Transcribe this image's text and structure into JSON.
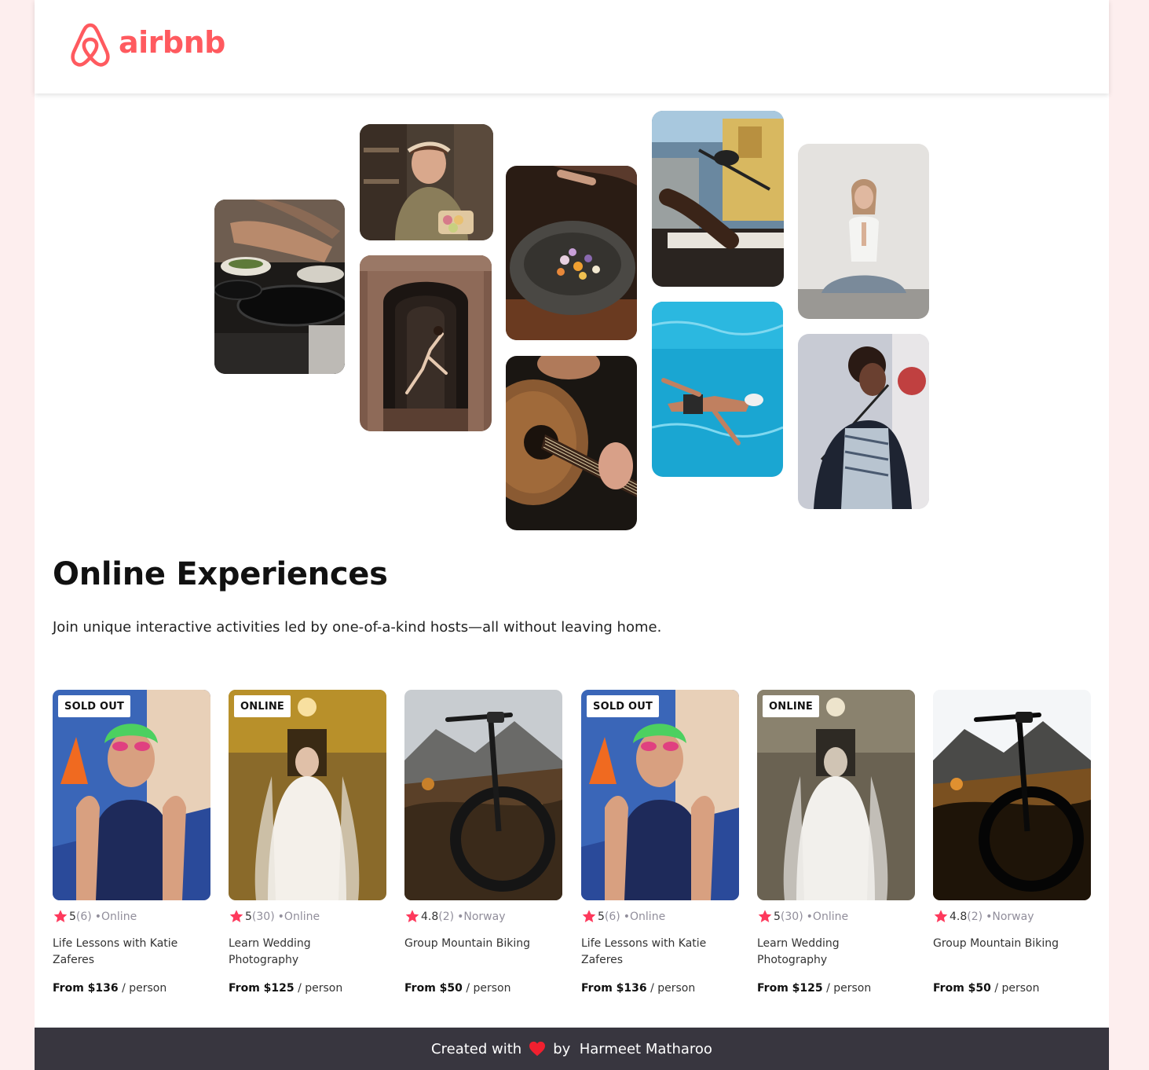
{
  "brand": {
    "name": "airbnb",
    "color": "#ff5a5f"
  },
  "hero": {
    "tiles": [
      {
        "subject": "cooking-pans"
      },
      {
        "subject": "woman-with-macarons"
      },
      {
        "subject": "dancer-in-doorway"
      },
      {
        "subject": "food-bowl"
      },
      {
        "subject": "guitar"
      },
      {
        "subject": "piano-and-microphone"
      },
      {
        "subject": "swimmer"
      },
      {
        "subject": "yoga"
      },
      {
        "subject": "singer"
      }
    ]
  },
  "heading": "Online Experiences",
  "subtext": "Join unique interactive activities led by one-of-a-kind hosts—all without leaving home.",
  "cards": [
    {
      "badge": "SOLD OUT",
      "rating": "5",
      "count": "(6)",
      "location": "•Online",
      "title": "Life Lessons with Katie Zaferes",
      "price_from": "From $136",
      "price_unit": " / person",
      "image": "athlete"
    },
    {
      "badge": "ONLINE",
      "rating": "5",
      "count": "(30)",
      "location": "•Online",
      "title": "Learn Wedding Photography",
      "price_from": "From $125",
      "price_unit": " / person",
      "image": "bride"
    },
    {
      "badge": "",
      "rating": "4.8",
      "count": "(2)",
      "location": "•Norway",
      "title": "Group Mountain Biking",
      "price_from": "From $50",
      "price_unit": " / person",
      "image": "bike"
    },
    {
      "badge": "SOLD OUT",
      "rating": "5",
      "count": "(6)",
      "location": "•Online",
      "title": "Life Lessons with Katie Zaferes",
      "price_from": "From $136",
      "price_unit": " / person",
      "image": "athlete"
    },
    {
      "badge": "ONLINE",
      "rating": "5",
      "count": "(30)",
      "location": "•Online",
      "title": "Learn Wedding Photography",
      "price_from": "From $125",
      "price_unit": " / person",
      "image": "bride-muted"
    },
    {
      "badge": "",
      "rating": "4.8",
      "count": "(2)",
      "location": "•Norway",
      "title": "Group Mountain Biking",
      "price_from": "From $50",
      "price_unit": " / person",
      "image": "bike-bright"
    }
  ],
  "footer": {
    "prefix": "Created with",
    "suffix": "by  Harmeet Matharoo"
  },
  "colors": {
    "star": "#fe395c",
    "footer_bg": "#38363f",
    "heart": "#f0202f"
  }
}
